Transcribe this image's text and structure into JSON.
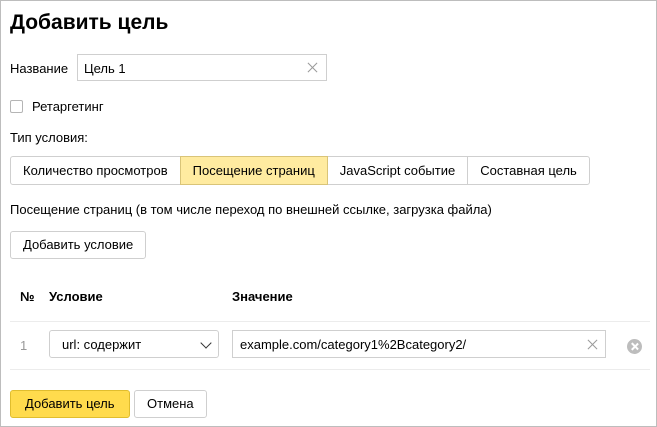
{
  "dialog": {
    "title": "Добавить цель",
    "name_label": "Название",
    "name_value": "Цель 1",
    "retargeting_label": "Ретаргетинг",
    "retargeting_checked": false,
    "condition_type_label": "Тип условия:",
    "tabs": [
      {
        "label": "Количество просмотров",
        "active": false
      },
      {
        "label": "Посещение страниц",
        "active": true
      },
      {
        "label": "JavaScript событие",
        "active": false
      },
      {
        "label": "Составная цель",
        "active": false
      }
    ],
    "description": "Посещение страниц (в том числе переход по внешней ссылке, загрузка файла)",
    "add_condition_label": "Добавить условие",
    "table": {
      "headers": {
        "num": "№",
        "condition": "Условие",
        "value": "Значение"
      },
      "rows": [
        {
          "num": "1",
          "condition": "url: содержит",
          "value": "example.com/category1%2Bcategory2/"
        }
      ]
    },
    "add_goal_label": "Добавить цель",
    "cancel_label": "Отмена"
  },
  "colors": {
    "active_tab": "#ffeba0",
    "primary_button": "#ffdb4d"
  },
  "icons": [
    "clear-icon",
    "chevron-down-icon",
    "remove-row-icon",
    "checkbox"
  ]
}
